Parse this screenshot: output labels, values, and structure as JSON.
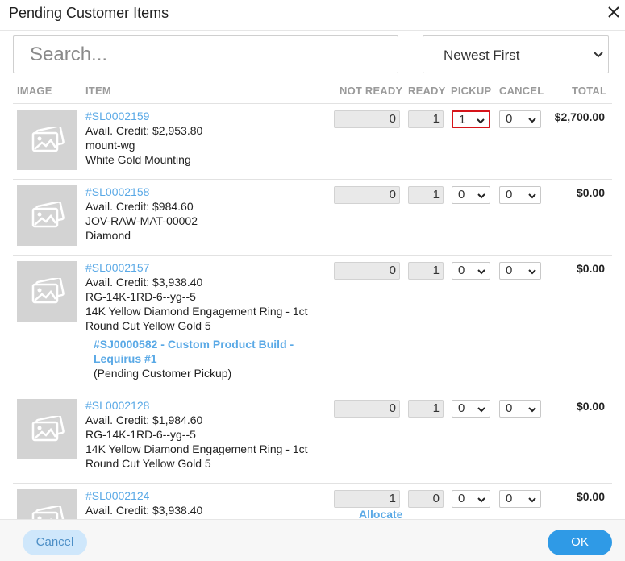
{
  "dialog": {
    "title": "Pending Customer Items"
  },
  "search": {
    "placeholder": "Search...",
    "value": ""
  },
  "sort": {
    "selected": "Newest First"
  },
  "columns": {
    "image": "IMAGE",
    "item": "ITEM",
    "not_ready": "NOT READY",
    "ready": "READY",
    "pickup": "PICKUP",
    "cancel": "CANCEL",
    "total": "TOTAL"
  },
  "items": [
    {
      "sku": "#SL0002159",
      "credit": "Avail. Credit: $2,953.80",
      "code": "mount-wg",
      "desc1": "White Gold Mounting",
      "not_ready": "0",
      "ready": "1",
      "pickup": "1",
      "cancel": "0",
      "total": "$2,700.00"
    },
    {
      "sku": "#SL0002158",
      "credit": "Avail. Credit: $984.60",
      "code": "JOV-RAW-MAT-00002",
      "desc1": "Diamond",
      "not_ready": "0",
      "ready": "1",
      "pickup": "0",
      "cancel": "0",
      "total": "$0.00"
    },
    {
      "sku": "#SL0002157",
      "credit": "Avail. Credit: $3,938.40",
      "code": "RG-14K-1RD-6--yg--5",
      "desc1": "14K Yellow Diamond Engagement Ring - 1ct",
      "desc2": "Round Cut Yellow Gold 5",
      "job_link_line1": "#SJ0000582 - Custom Product Build -",
      "job_link_line2": "Lequirus #1",
      "job_status": "(Pending Customer Pickup)",
      "not_ready": "0",
      "ready": "1",
      "pickup": "0",
      "cancel": "0",
      "total": "$0.00"
    },
    {
      "sku": "#SL0002128",
      "credit": "Avail. Credit: $1,984.60",
      "code": "RG-14K-1RD-6--yg--5",
      "desc1": "14K Yellow Diamond Engagement Ring - 1ct",
      "desc2": "Round Cut Yellow Gold 5",
      "not_ready": "0",
      "ready": "1",
      "pickup": "0",
      "cancel": "0",
      "total": "$0.00"
    },
    {
      "sku": "#SL0002124",
      "credit": "Avail. Credit: $3,938.40",
      "not_ready": "1",
      "ready": "0",
      "pickup": "0",
      "cancel": "0",
      "total": "$0.00",
      "allocate": "Allocate"
    }
  ],
  "footer": {
    "cancel_label": "Cancel",
    "ok_label": "OK"
  },
  "colors": {
    "accent": "#2f9ae6",
    "link": "#5aa9e6",
    "highlight": "#d6141a",
    "cancel_bg": "#cfe7fb"
  },
  "icons": {
    "close": "close-icon",
    "sort": "chevron-down-icon",
    "thumbnail": "image-placeholder-icon"
  }
}
